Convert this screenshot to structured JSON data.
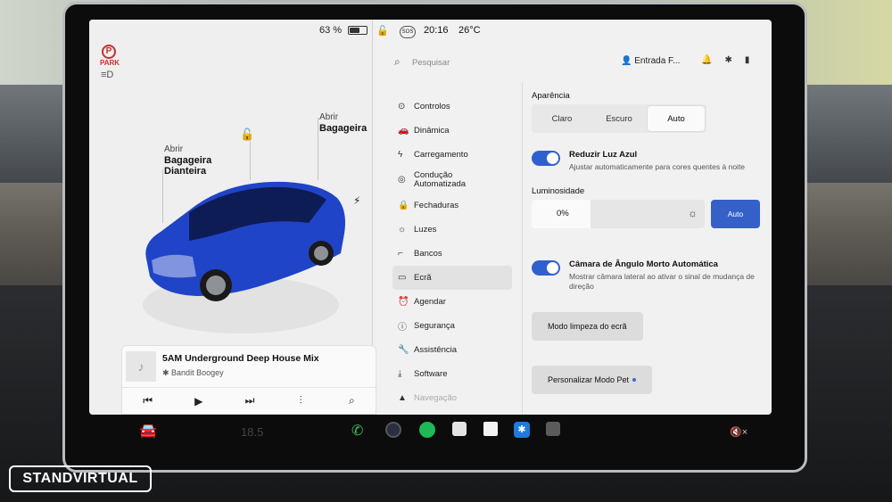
{
  "status": {
    "battery": "63 %",
    "battery_level": 0.63,
    "time": "20:16",
    "temperature": "26°C",
    "sos": "SOS"
  },
  "icons": {
    "park": "P",
    "park_text": "PARK"
  },
  "car": {
    "front_trunk_line1": "Abrir",
    "front_trunk_line2": "Bagageira",
    "front_trunk_line3": "Dianteira",
    "rear_trunk_line1": "Abrir",
    "rear_trunk_line2": "Bagageira",
    "color": "#1f44c8"
  },
  "media": {
    "title": "5AM Underground Deep House Mix",
    "artist": "Bandit Boogey"
  },
  "search": {
    "placeholder": "Pesquisar"
  },
  "profile": {
    "name": "Entrada F..."
  },
  "nav": {
    "items": [
      {
        "label": "Controlos"
      },
      {
        "label": "Dinâmica"
      },
      {
        "label": "Carregamento"
      },
      {
        "label_line1": "Condução",
        "label_line2": "Automatizada"
      },
      {
        "label": "Fechaduras"
      },
      {
        "label": "Luzes"
      },
      {
        "label": "Bancos"
      },
      {
        "label": "Ecrã"
      },
      {
        "label": "Agendar"
      },
      {
        "label": "Segurança"
      },
      {
        "label": "Assistência"
      },
      {
        "label": "Software"
      },
      {
        "label": "Navegação"
      }
    ]
  },
  "display": {
    "appearance_label": "Aparência",
    "appearance_options": [
      "Claro",
      "Escuro",
      "Auto"
    ],
    "appearance_selected": "Auto",
    "blue_light_title": "Reduzir Luz Azul",
    "blue_light_desc": "Ajustar automaticamente para cores quentes à noite",
    "brightness_label": "Luminosidade",
    "brightness_value": "0%",
    "brightness_fraction": 0.34,
    "brightness_auto": "Auto",
    "blind_spot_title": "Câmara de Ângulo Morto Automática",
    "blind_spot_desc": "Mostrar câmara lateral ao ativar o sinal de mudança de direção",
    "clean_mode": "Modo limpeza do ecrã",
    "pet_mode": "Personalizar Modo Pet"
  },
  "dock": {
    "temperature": "18.5"
  },
  "watermark": "STANDVIRTUAL",
  "colors": {
    "accent": "#3560c8",
    "toggle": "#3060d0",
    "phone": "#3cc25a",
    "spotify": "#1db954",
    "park": "#c8302c"
  }
}
